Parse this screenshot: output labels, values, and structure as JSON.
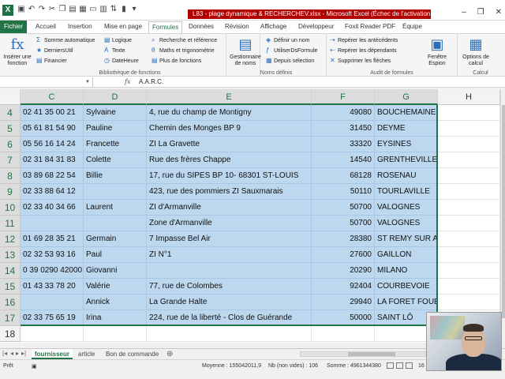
{
  "titlebar": {
    "doc_title": "L83 - plage dynamique & RECHERCHEV.xlsx - Microsoft Excel (Échec de l'activation d...",
    "window_buttons": [
      "–",
      "❐",
      "✕"
    ]
  },
  "tabs": [
    "Fichier",
    "Accueil",
    "Insertion",
    "Mise en page",
    "Formules",
    "Données",
    "Révision",
    "Affichage",
    "Développeur",
    "Foxit Reader PDF",
    "Équipe"
  ],
  "active_tab": "Formules",
  "ribbon": {
    "insert_function": "Insérer une fonction",
    "library": {
      "col1": [
        "Somme automatique",
        "DerniersUtil",
        "Financier"
      ],
      "col2": [
        "Logique",
        "Texte",
        "DateHeure"
      ],
      "col3": [
        "Recherche et référence",
        "Maths et trigonométrie",
        "Plus de fonctions"
      ],
      "label": "Bibliothèque de fonctions"
    },
    "names": {
      "manager": "Gestionnaire de noms",
      "items": [
        "Définir un nom",
        "UtiliserDsFormule",
        "Depuis sélection"
      ],
      "label": "Noms définis"
    },
    "audit": {
      "items": [
        "Repérer les antécédents",
        "Repérer les dépendants",
        "Supprimer les flèches"
      ],
      "watch": "Fenêtre Espion",
      "label": "Audit de formules"
    },
    "calc": {
      "options": "Options de calcul",
      "label": "Calcul"
    }
  },
  "formula_bar": {
    "name_box": "",
    "fx": "fx",
    "value": "A.A.R.C."
  },
  "columns": [
    "C",
    "D",
    "E",
    "F",
    "G",
    "H"
  ],
  "rows": [
    {
      "n": "4",
      "C": "02 41 35 00 21",
      "D": "Sylvaine",
      "E": "4, rue du champ de Montigny",
      "F": "49080",
      "G": "BOUCHEMAINE"
    },
    {
      "n": "5",
      "C": "05 61 81 54 90",
      "D": "Pauline",
      "E": "Chemin des Monges  BP 9",
      "F": "31450",
      "G": "DEYME"
    },
    {
      "n": "6",
      "C": "05 56 16 14 24",
      "D": "Francette",
      "E": "ZI La Gravette",
      "F": "33320",
      "G": "EYSINES"
    },
    {
      "n": "7",
      "C": "02 31 84 31 83",
      "D": "Colette",
      "E": "Rue des frères Chappe",
      "F": "14540",
      "G": "GRENTHEVILLE"
    },
    {
      "n": "8",
      "C": "03 89 68 22 54",
      "D": "Billie",
      "E": "17, rue du SIPES BP 10- 68301 ST-LOUIS",
      "F": "68128",
      "G": "ROSENAU"
    },
    {
      "n": "9",
      "C": "02 33 88 64 12",
      "D": "",
      "E": "423, rue des pommiers ZI Sauxmarais",
      "F": "50110",
      "G": "TOURLAVILLE"
    },
    {
      "n": "10",
      "C": "02 33 40 34 66",
      "D": "Laurent",
      "E": "ZI d'Armanville",
      "F": "50700",
      "G": "VALOGNES"
    },
    {
      "n": "11",
      "C": "",
      "D": "",
      "E": "Zone d'Armanville",
      "F": "50700",
      "G": "VALOGNES"
    },
    {
      "n": "12",
      "C": "01 69 28 35 21",
      "D": "Germain",
      "E": "7 Impasse Bel Air",
      "F": "28380",
      "G": "ST REMY SUR AVRE"
    },
    {
      "n": "13",
      "C": "02 32 53 93 16",
      "D": "Paul",
      "E": "ZI N°1",
      "F": "27600",
      "G": "GAILLON"
    },
    {
      "n": "14",
      "C": "0 39  0290 42000",
      "D": "Giovanni",
      "E": "",
      "F": "20290",
      "G": "MILANO"
    },
    {
      "n": "15",
      "C": "01 43 33 78 20",
      "D": "Valérie",
      "E": "77, rue de Colombes",
      "F": "92404",
      "G": "COURBEVOIE"
    },
    {
      "n": "16",
      "C": "",
      "D": "Annick",
      "E": "La Grande Halte",
      "F": "29940",
      "G": "LA FORET FOUESNANT"
    },
    {
      "n": "17",
      "C": "02 33 75 65 19",
      "D": "Irina",
      "E": "224, rue de la liberté - Clos de Guérande",
      "F": "50000",
      "G": "SAINT LÔ"
    },
    {
      "n": "18",
      "C": "",
      "D": "",
      "E": "",
      "F": "",
      "G": ""
    }
  ],
  "sheets": [
    "fournisseur",
    "article",
    "Bon de commande"
  ],
  "active_sheet": "fournisseur",
  "status": {
    "ready": "Prêt",
    "average": "Moyenne : 155042011,9",
    "count": "Nb (non vides) : 106",
    "sum": "Somme : 4961344380",
    "zoom": "16"
  },
  "colors": {
    "excel_green": "#217346",
    "selection_fill": "#bdd7ee",
    "title_alert": "#b00000"
  }
}
